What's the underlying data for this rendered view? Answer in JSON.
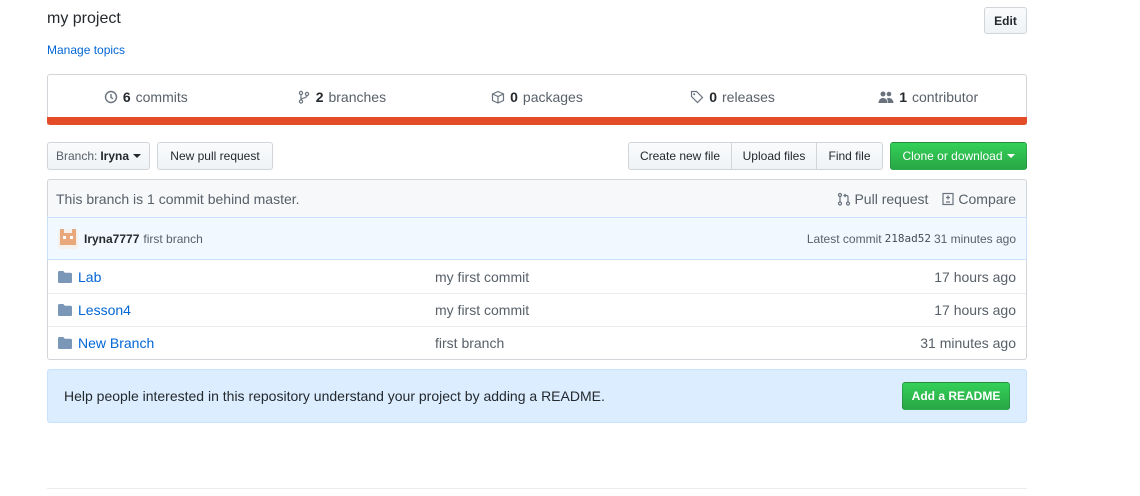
{
  "repo": {
    "description": "my project",
    "manage_topics": "Manage topics",
    "edit_label": "Edit"
  },
  "summary": {
    "commits": {
      "count": "6",
      "label": "commits"
    },
    "branches": {
      "count": "2",
      "label": "branches"
    },
    "packages": {
      "count": "0",
      "label": "packages"
    },
    "releases": {
      "count": "0",
      "label": "releases"
    },
    "contributors": {
      "count": "1",
      "label": "contributor"
    },
    "language_color": "#e34c26"
  },
  "toolbar": {
    "branch_prefix": "Branch:",
    "branch_name": "Iryna",
    "new_pull_request": "New pull request",
    "create_new_file": "Create new file",
    "upload_files": "Upload files",
    "find_file": "Find file",
    "clone_or_download": "Clone or download"
  },
  "branch_info": {
    "text": "This branch is 1 commit behind master.",
    "pull_request": "Pull request",
    "compare": "Compare"
  },
  "latest_commit": {
    "author": "Iryna7777",
    "message": "first branch",
    "prefix": "Latest commit",
    "sha": "218ad52",
    "age": "31 minutes ago"
  },
  "files": [
    {
      "name": "Lab",
      "message": "my first commit",
      "age": "17 hours ago"
    },
    {
      "name": "Lesson4",
      "message": "my first commit",
      "age": "17 hours ago"
    },
    {
      "name": "New Branch",
      "message": "first branch",
      "age": "31 minutes ago"
    }
  ],
  "readme_prompt": {
    "text": "Help people interested in this repository understand your project by adding a README.",
    "button": "Add a README"
  }
}
